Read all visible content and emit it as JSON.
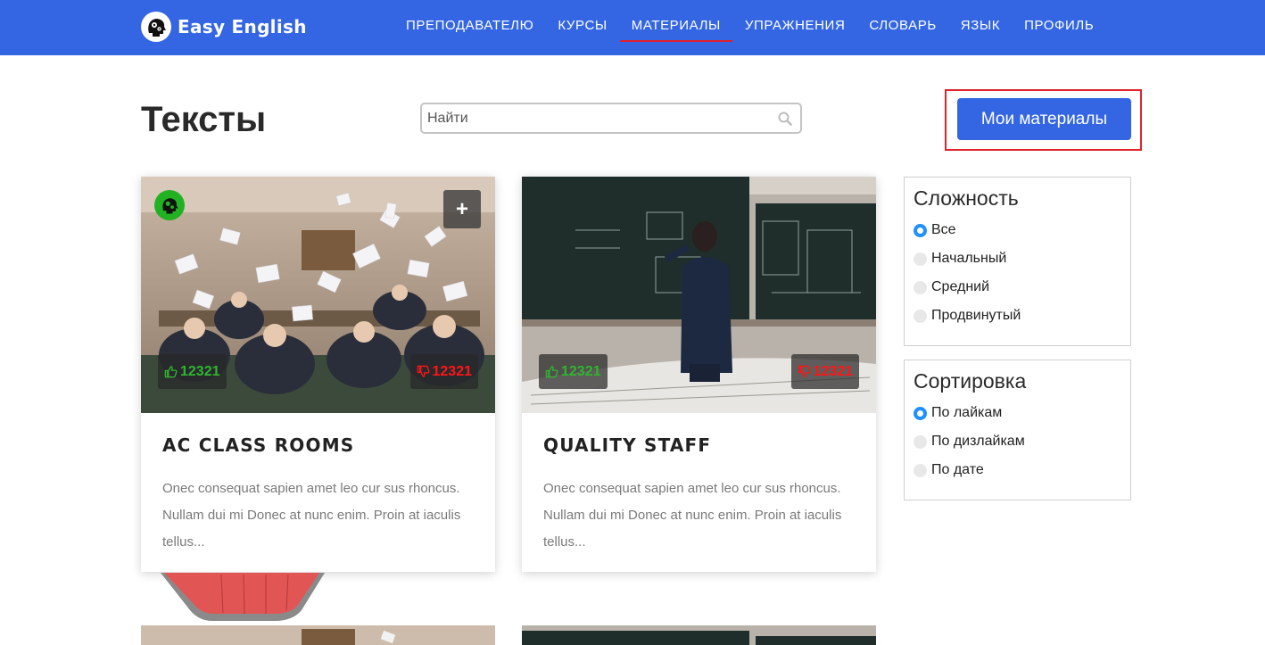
{
  "brand": {
    "name": "Easy English"
  },
  "nav": {
    "items": [
      {
        "label": "ПРЕПОДАВАТЕЛЮ"
      },
      {
        "label": "КУРСЫ"
      },
      {
        "label": "МАТЕРИАЛЫ",
        "active": true
      },
      {
        "label": "УПРАЖНЕНИЯ"
      },
      {
        "label": "СЛОВАРЬ"
      },
      {
        "label": "ЯЗЫК"
      },
      {
        "label": "ПРОФИЛЬ"
      }
    ]
  },
  "page": {
    "title": "Тексты"
  },
  "search": {
    "placeholder": "Найти",
    "value": ""
  },
  "my_materials_button": "Мои материалы",
  "cards": [
    {
      "title": "AC CLASS ROOMS",
      "text": "Onec consequat sapien amet leo cur sus rhoncus. Nullam dui mi Donec at nunc enim. Proin at iaculis tellus...",
      "likes": "12321",
      "dislikes": "12321",
      "add_label": "+"
    },
    {
      "title": "QUALITY STAFF",
      "text": "Onec consequat sapien amet leo cur sus rhoncus. Nullam dui mi Donec at nunc enim. Proin at iaculis tellus...",
      "likes": "12321",
      "dislikes": "12321"
    }
  ],
  "filters": {
    "difficulty": {
      "title": "Сложность",
      "options": [
        {
          "label": "Все",
          "checked": true
        },
        {
          "label": "Начальный",
          "checked": false
        },
        {
          "label": "Средний",
          "checked": false
        },
        {
          "label": "Продвинутый",
          "checked": false
        }
      ]
    },
    "sort": {
      "title": "Сортировка",
      "options": [
        {
          "label": "По лайкам",
          "checked": true
        },
        {
          "label": "По дизлайкам",
          "checked": false
        },
        {
          "label": "По дате",
          "checked": false
        }
      ]
    }
  },
  "colors": {
    "primary": "#3466e3",
    "active_underline": "#e02030",
    "like": "#2fb52f",
    "dislike": "#ff1515",
    "radio_checked": "#1e90ff"
  },
  "icons": [
    "brain-gears-icon",
    "search-icon",
    "plus-icon",
    "thumbs-up-icon",
    "thumbs-down-icon"
  ]
}
